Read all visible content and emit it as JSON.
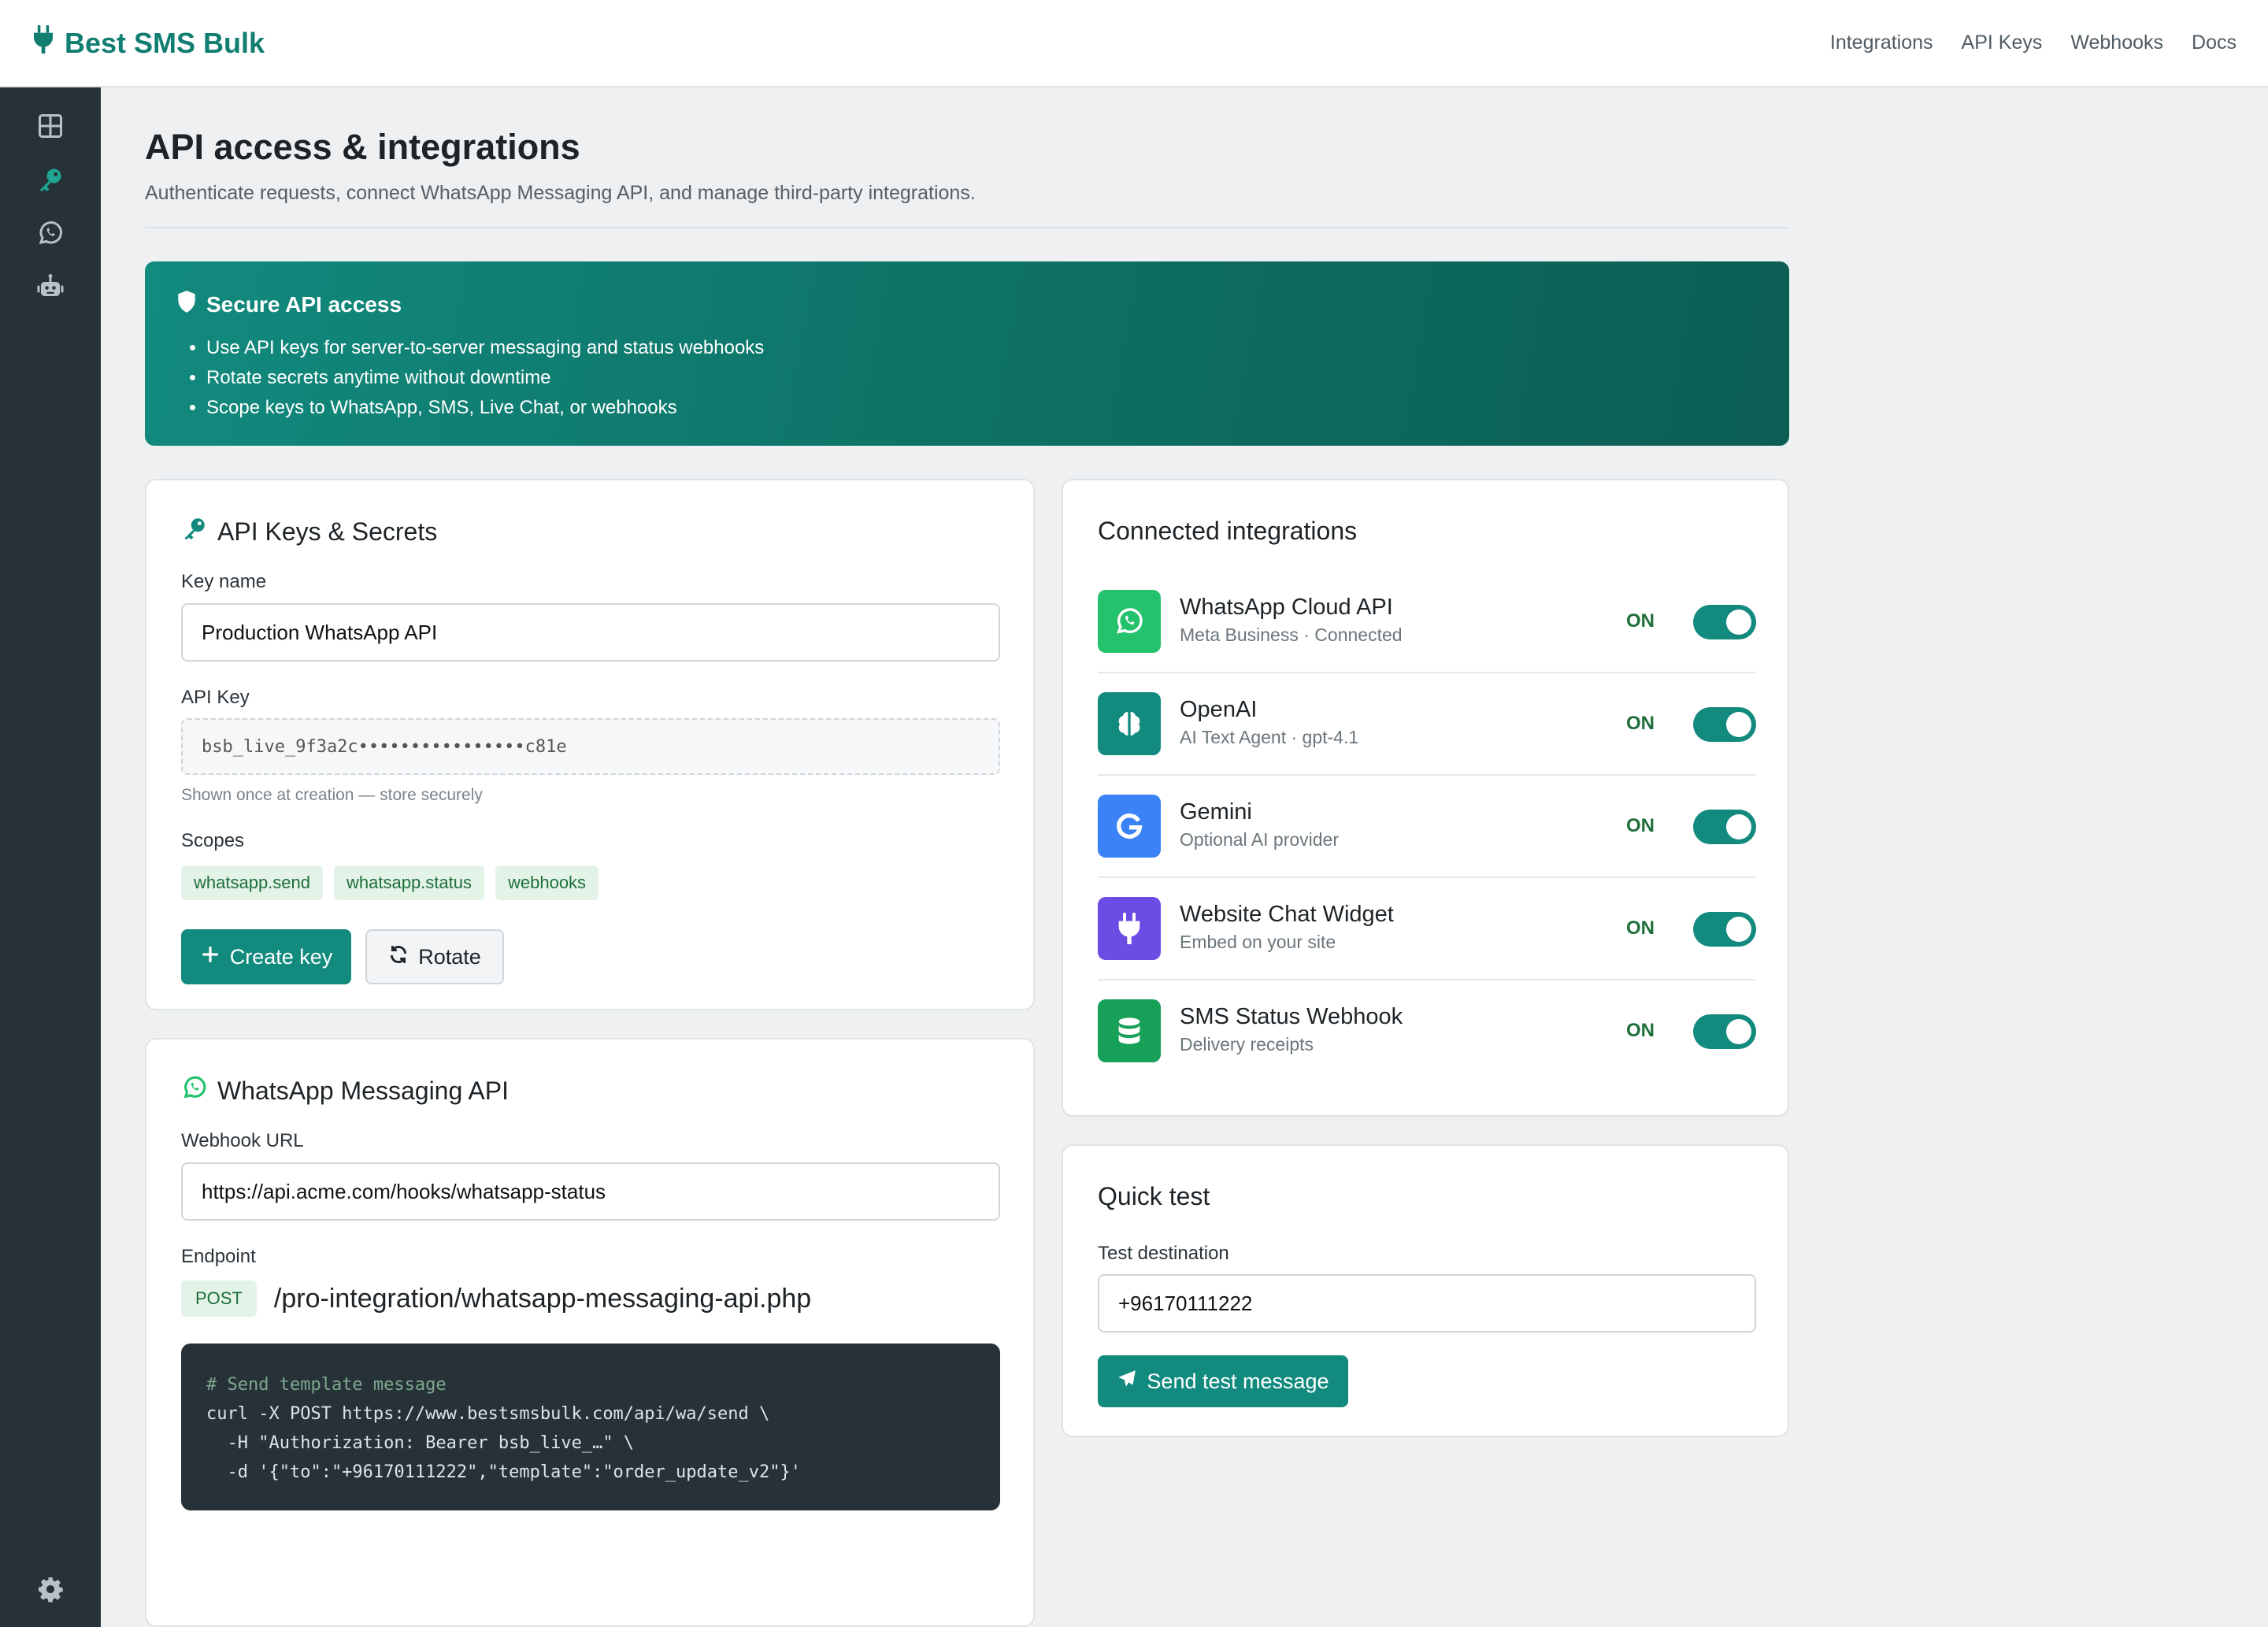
{
  "app": {
    "brand": "Best SMS Bulk"
  },
  "topnav": [
    {
      "label": "Integrations"
    },
    {
      "label": "API Keys"
    },
    {
      "label": "Webhooks"
    },
    {
      "label": "Docs"
    }
  ],
  "sidebar": {
    "icons": [
      "grid-icon",
      "key-icon",
      "whatsapp-icon",
      "robot-icon"
    ],
    "bottom_icon": "gear-icon"
  },
  "page": {
    "title": "API access & integrations",
    "subtitle": "Authenticate requests, connect WhatsApp Messaging API, and manage third-party integrations."
  },
  "hero": {
    "title": "Secure API access",
    "bullets": [
      "Use API keys for server-to-server messaging and status webhooks",
      "Rotate secrets anytime without downtime",
      "Scope keys to WhatsApp, SMS, Live Chat, or webhooks"
    ]
  },
  "api_keys": {
    "title": "API Keys & Secrets",
    "key_name_label": "Key name",
    "key_name_value": "Production WhatsApp API",
    "api_key_label": "API Key",
    "api_key_value": "bsb_live_9f3a2c••••••••••••••••c81e",
    "hint": "Shown once at creation — store securely",
    "scopes_label": "Scopes",
    "scopes": [
      "whatsapp.send",
      "whatsapp.status",
      "webhooks"
    ],
    "create_label": "Create key",
    "rotate_label": "Rotate"
  },
  "whatsapp": {
    "title": "WhatsApp Messaging API",
    "webhook_label": "Webhook URL",
    "webhook_value": "https://api.acme.com/hooks/whatsapp-status",
    "endpoint_label": "Endpoint",
    "method": "POST",
    "path": "/pro-integration/whatsapp-messaging-api.php",
    "code_comment": "# Send template message",
    "code_lines": [
      "curl -X POST https://www.bestsmsbulk.com/api/wa/send \\",
      "  -H \"Authorization: Bearer bsb_live_…\" \\",
      "  -d '{\"to\":\"+96170111222\",\"template\":\"order_update_v2\"}'"
    ]
  },
  "integrations": {
    "title": "Connected integrations",
    "items": [
      {
        "name": "WhatsApp Cloud API",
        "sub": "Meta Business · Connected",
        "status": "ON",
        "icon": "whatsapp-icon",
        "color": "#25c26e",
        "enabled": true
      },
      {
        "name": "OpenAI",
        "sub": "AI Text Agent · gpt-4.1",
        "status": "ON",
        "icon": "brain-icon",
        "color": "#128a7e",
        "enabled": true
      },
      {
        "name": "Gemini",
        "sub": "Optional AI provider",
        "status": "ON",
        "icon": "google-icon",
        "color": "#3b82f6",
        "enabled": true
      },
      {
        "name": "Website Chat Widget",
        "sub": "Embed on your site",
        "status": "ON",
        "icon": "plug-icon",
        "color": "#6b4de6",
        "enabled": true
      },
      {
        "name": "SMS Status Webhook",
        "sub": "Delivery receipts",
        "status": "ON",
        "icon": "database-icon",
        "color": "#16a058",
        "enabled": true
      }
    ]
  },
  "quick_test": {
    "title": "Quick test",
    "dest_label": "Test destination",
    "dest_value": "+96170111222",
    "send_label": "Send test message"
  }
}
